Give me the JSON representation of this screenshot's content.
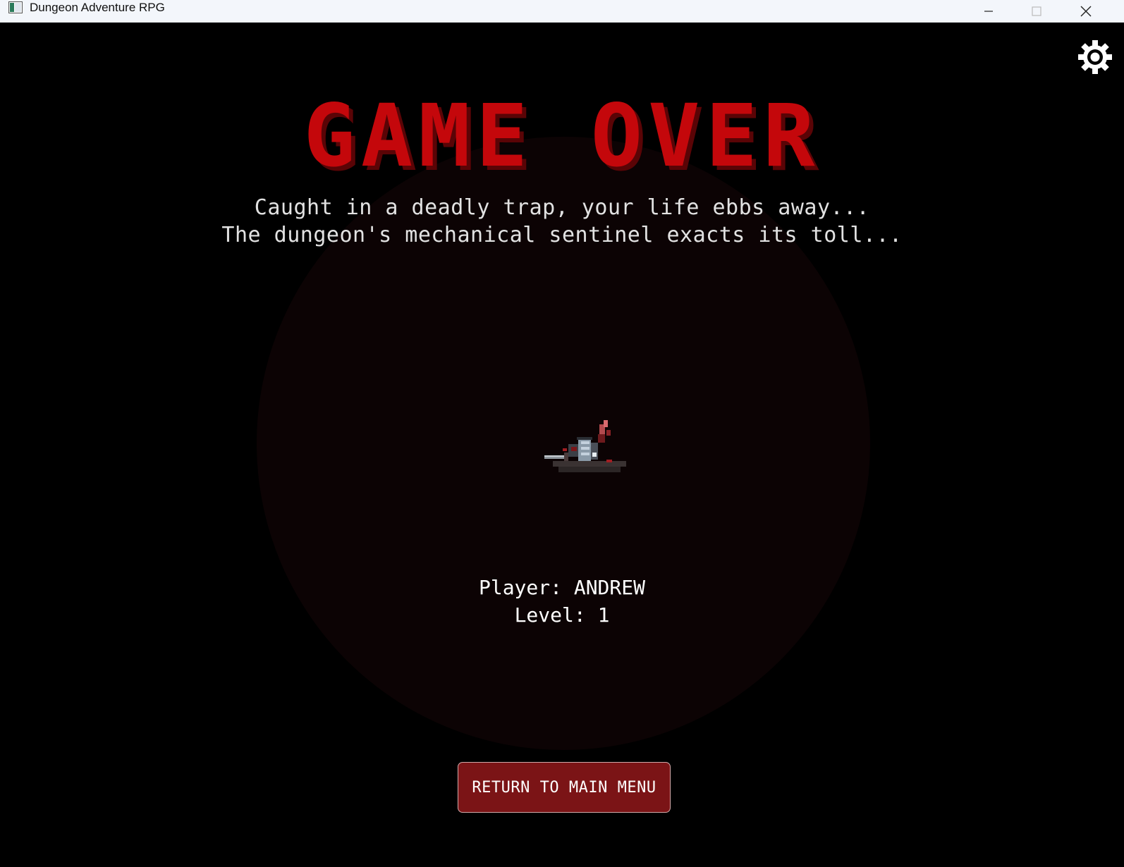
{
  "window": {
    "title": "Dungeon Adventure RPG",
    "icons": [
      "app-icon",
      "minimize-icon",
      "maximize-icon",
      "close-icon"
    ]
  },
  "settings": {
    "icon": "gear-icon"
  },
  "game_over": {
    "title": "GAME OVER",
    "flavor_line_1": "Caught in a deadly trap, your life ebbs away...",
    "flavor_line_2": "The dungeon's mechanical sentinel exacts its toll..."
  },
  "player": {
    "name_line": "Player: ANDREW",
    "level_line": "Level: 1"
  },
  "actions": {
    "return_label": "RETURN TO MAIN MENU"
  },
  "colors": {
    "title_red": "#c4070b",
    "title_shadow": "#5a0406",
    "button_bg": "#7b1416",
    "text_light": "#e2e2e2"
  }
}
